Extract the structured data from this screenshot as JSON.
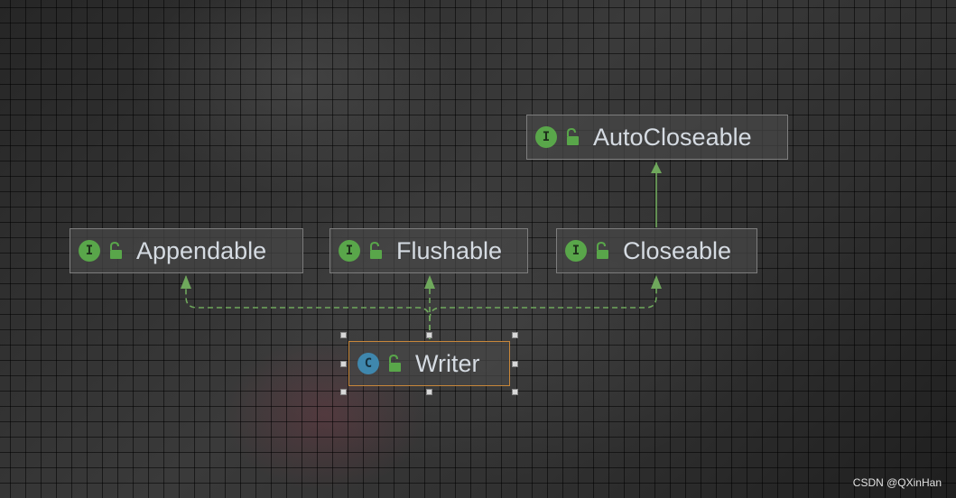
{
  "diagram": {
    "nodes": [
      {
        "id": "autocloseable",
        "kind": "I",
        "name": "AutoCloseable"
      },
      {
        "id": "appendable",
        "kind": "I",
        "name": "Appendable"
      },
      {
        "id": "flushable",
        "kind": "I",
        "name": "Flushable"
      },
      {
        "id": "closeable",
        "kind": "I",
        "name": "Closeable"
      },
      {
        "id": "writer",
        "kind": "C",
        "name": "Writer"
      }
    ],
    "edges": [
      {
        "from": "closeable",
        "to": "autocloseable",
        "style": "solid",
        "meaning": "extends"
      },
      {
        "from": "writer",
        "to": "appendable",
        "style": "dashed",
        "meaning": "implements"
      },
      {
        "from": "writer",
        "to": "flushable",
        "style": "dashed",
        "meaning": "implements"
      },
      {
        "from": "writer",
        "to": "closeable",
        "style": "dashed",
        "meaning": "implements"
      }
    ],
    "selected_node": "writer"
  },
  "icons": {
    "interface_badge": "interface-icon",
    "class_badge": "class-icon",
    "visibility": "unlocked-public-icon"
  },
  "colors": {
    "interface_badge": "#59a64a",
    "class_badge": "#3f87ad",
    "edge": "#6fa85c",
    "selected_border": "#c8873a",
    "label_text": "#d5dbe2"
  },
  "watermark": "CSDN @QXinHan"
}
